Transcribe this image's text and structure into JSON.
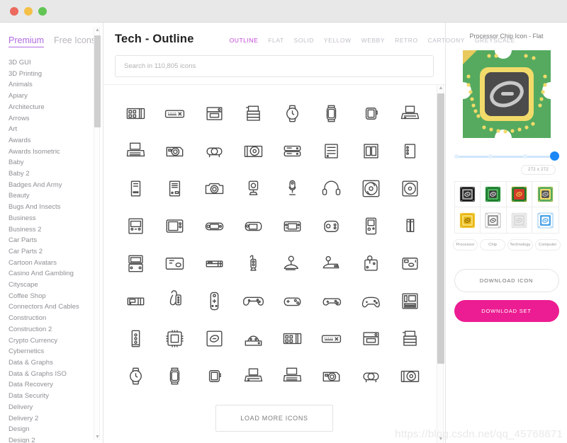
{
  "window": {
    "traffic_lights": [
      "close",
      "minimize",
      "maximize"
    ],
    "colors": {
      "close": "#ec6a5e",
      "minimize": "#f4c048",
      "maximize": "#62c554"
    }
  },
  "sidebar": {
    "tabs": [
      {
        "label": "Premium",
        "active": true
      },
      {
        "label": "Free Icons",
        "active": false
      }
    ],
    "categories": [
      "3D GUI",
      "3D Printing",
      "Animals",
      "Apiary",
      "Architecture",
      "Arrows",
      "Art",
      "Awards",
      "Awards Isometric",
      "Baby",
      "Baby 2",
      "Badges And Army",
      "Beauty",
      "Bugs And Insects",
      "Business",
      "Business 2",
      "Car Parts",
      "Car Parts 2",
      "Cartoon Avatars",
      "Casino And Gambling",
      "Cityscape",
      "Coffee Shop",
      "Connectors And Cables",
      "Construction",
      "Construction 2",
      "Crypto Currency",
      "Cybernetics",
      "Data & Graphs",
      "Data & Graphs ISO",
      "Data Recovery",
      "Data Security",
      "Delivery",
      "Delivery 2",
      "Design",
      "Design 2"
    ]
  },
  "main": {
    "set_title": "Tech - Outline",
    "style_tabs": [
      {
        "label": "OUTLINE",
        "active": true
      },
      {
        "label": "FLAT",
        "active": false
      },
      {
        "label": "SOLID",
        "active": false
      },
      {
        "label": "YELLOW",
        "active": false
      },
      {
        "label": "WEBBY",
        "active": false
      },
      {
        "label": "RETRO",
        "active": false
      },
      {
        "label": "CARTOONY",
        "active": false
      },
      {
        "label": "GREYSCALE",
        "active": false
      }
    ],
    "search": {
      "value": "",
      "placeholder": "Search in 110,805 icons"
    },
    "load_more_label": "LOAD MORE ICONS",
    "accent_color": "#c042d6",
    "grid_rows": 8,
    "grid_cols": 8,
    "icon_names": [
      "graphics-card-icon",
      "keyboard-icon",
      "copier-machine-icon",
      "printer-stand-icon",
      "wristwatch-icon",
      "smartwatch-icon",
      "smartwatch-square-icon",
      "typewriter-icon",
      "typewriter-2-icon",
      "camera-old-icon",
      "projector-icon",
      "gpu-fan-icon",
      "server-rack-icon",
      "server-unit-icon",
      "server-blade-icon",
      "server-tower-icon",
      "desktop-tower-icon",
      "desktop-case-icon",
      "dslr-camera-icon",
      "webcam-icon",
      "microphone-icon",
      "headphones-icon",
      "cooling-fan-icon",
      "fan-unit-icon",
      "arcade-cabinet-icon",
      "crt-tv-icon",
      "handheld-console-icon",
      "handheld-console-2-icon",
      "handheld-tablet-console-icon",
      "handheld-round-icon",
      "game-boy-icon",
      "battery-pack-icon",
      "dual-screen-console-icon",
      "tv-panel-icon",
      "console-slim-icon",
      "game-console-icon",
      "joystick-icon",
      "arcade-stick-icon",
      "joystick-base-icon",
      "cartridge-icon",
      "vcr-icon",
      "remote-cable-icon",
      "remote-control-icon",
      "gamepad-icon",
      "retro-controller-icon",
      "classic-controller-icon",
      "modern-controller-icon",
      "motherboard-icon",
      "ram-stick-icon",
      "cpu-chip-icon",
      "processor-icon",
      "console-base-icon"
    ]
  },
  "right_panel": {
    "title": "Processor Chip Icon - Flat",
    "preview_icon": "processor-chip-icon",
    "slider": {
      "value": 100,
      "ticks": 4
    },
    "size_label": "272 x 272",
    "thumbnails": [
      {
        "name": "processor-black-thumb",
        "style": "black"
      },
      {
        "name": "processor-green-thumb",
        "style": "green"
      },
      {
        "name": "processor-red-thumb",
        "style": "red"
      },
      {
        "name": "processor-flat-thumb",
        "style": "flat-green"
      },
      {
        "name": "processor-yellow-thumb",
        "style": "yellow"
      },
      {
        "name": "processor-outline-thumb",
        "style": "outline"
      },
      {
        "name": "processor-grey-thumb",
        "style": "greyscale"
      },
      {
        "name": "processor-blue-thumb",
        "style": "blue"
      }
    ],
    "tags": [
      "Processor",
      "Chip",
      "Technology",
      "Computer"
    ],
    "download_icon_label": "DOWNLOAD ICON",
    "download_set_label": "DOWNLOAD SET",
    "download_set_color": "#ec1d92"
  },
  "watermark": "https://blog.csdn.net/qq_45768871"
}
